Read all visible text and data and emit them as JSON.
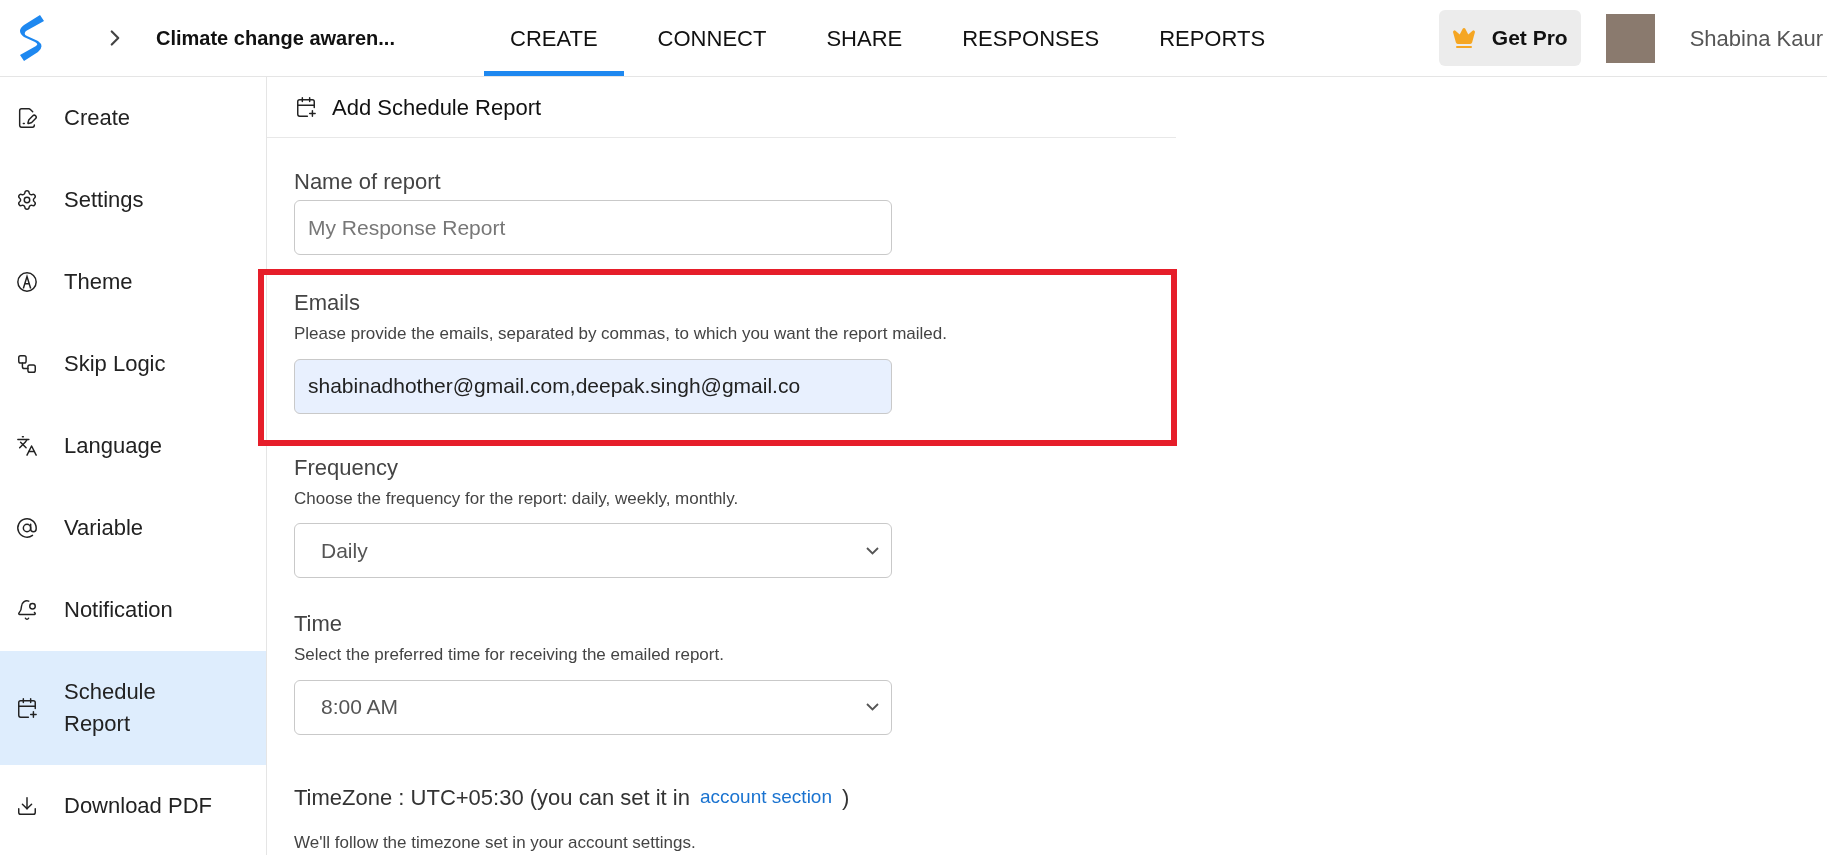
{
  "header": {
    "breadcrumb_title": "Climate change awaren...",
    "tabs": [
      {
        "label": "CREATE",
        "selected": true
      },
      {
        "label": "CONNECT",
        "selected": false
      },
      {
        "label": "SHARE",
        "selected": false
      },
      {
        "label": "RESPONSES",
        "selected": false
      },
      {
        "label": "REPORTS",
        "selected": false
      }
    ],
    "get_pro": "Get Pro",
    "user_name": "Shabina Kaur"
  },
  "sidebar": {
    "items": [
      {
        "label": "Create",
        "selected": false
      },
      {
        "label": "Settings",
        "selected": false
      },
      {
        "label": "Theme",
        "selected": false
      },
      {
        "label": "Skip Logic",
        "selected": false
      },
      {
        "label": "Language",
        "selected": false
      },
      {
        "label": "Variable",
        "selected": false
      },
      {
        "label": "Notification",
        "selected": false
      },
      {
        "label": "Schedule Report",
        "selected": true
      },
      {
        "label": "Download PDF",
        "selected": false
      }
    ]
  },
  "panel": {
    "title": "Add Schedule Report",
    "fields": [
      {
        "kind": "text",
        "label": "Name of report",
        "placeholder": "My Response Report",
        "highlighted": false
      },
      {
        "kind": "text",
        "label": "Emails",
        "help": "Please provide the emails, separated by commas, to which you want the report mailed.",
        "value": "shabinadhother@gmail.com,deepak.singh@gmail.co",
        "highlighted": true
      },
      {
        "kind": "select",
        "label": "Frequency",
        "help": "Choose the frequency for the report: daily, weekly, monthly.",
        "value": "Daily",
        "highlighted": false
      },
      {
        "kind": "select",
        "label": "Time",
        "help": "Select the preferred time for receiving the emailed report.",
        "value": "8:00 AM",
        "highlighted": false
      }
    ],
    "timezone": {
      "text": "TimeZone : UTC+05:30 (you can set it in",
      "link": "account section",
      "close": ")",
      "help": "We'll follow the timezone set in your account settings."
    }
  }
}
